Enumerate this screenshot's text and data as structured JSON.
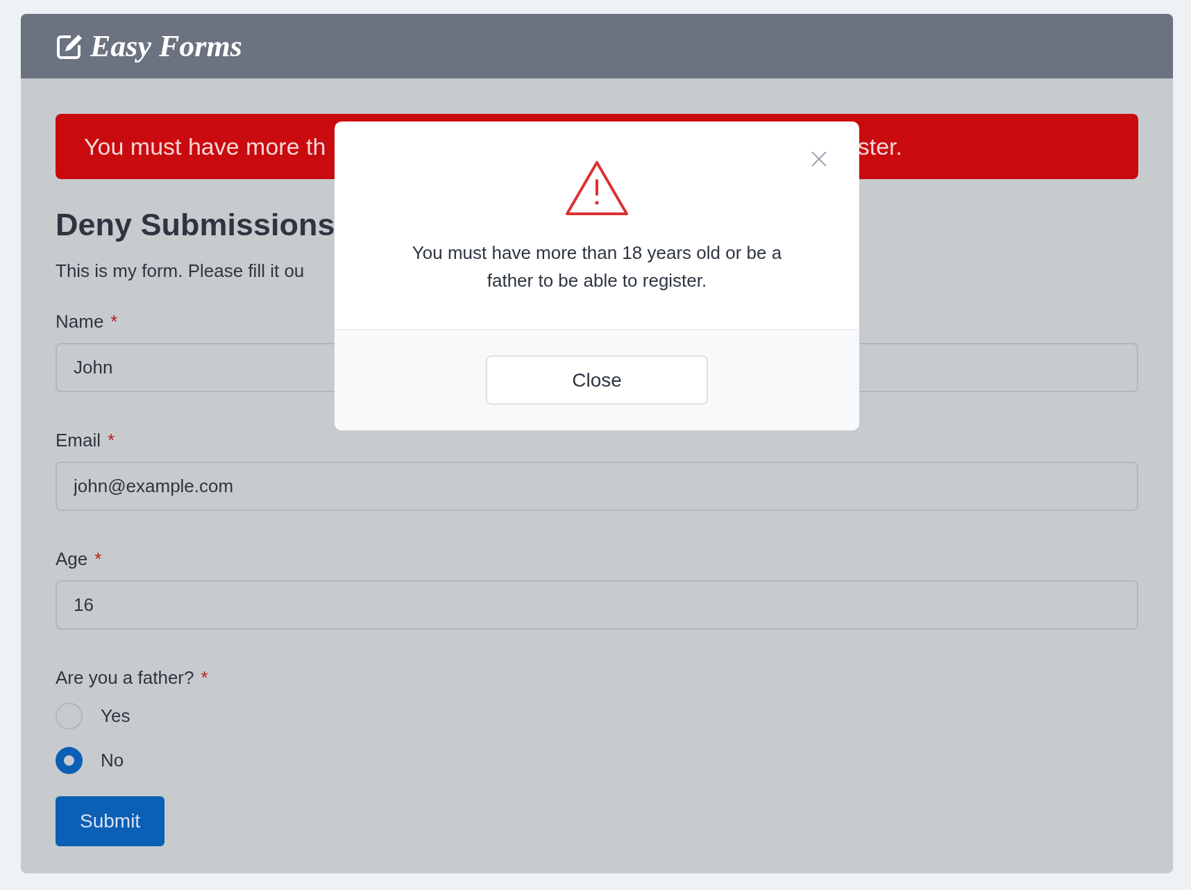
{
  "header": {
    "logo": "Easy Forms"
  },
  "alert": {
    "text_before": "You must have more th",
    "text_after": "ster."
  },
  "form": {
    "title": "Deny Submissions",
    "description": "This is my form. Please fill it ou",
    "required_mark": "*",
    "fields": [
      {
        "kind": "text",
        "label": "Name",
        "required": true,
        "value": "John"
      },
      {
        "kind": "text",
        "label": "Email",
        "required": true,
        "value": "john@example.com"
      },
      {
        "kind": "text",
        "label": "Age",
        "required": true,
        "value": "16"
      },
      {
        "kind": "radio",
        "label": "Are you a father?",
        "required": true,
        "options": [
          {
            "label": "Yes",
            "selected": false
          },
          {
            "label": "No",
            "selected": true
          }
        ]
      }
    ],
    "submit": "Submit"
  },
  "modal": {
    "message": "You must have more than 18 years old or be a father to be able to register.",
    "button": "Close"
  }
}
